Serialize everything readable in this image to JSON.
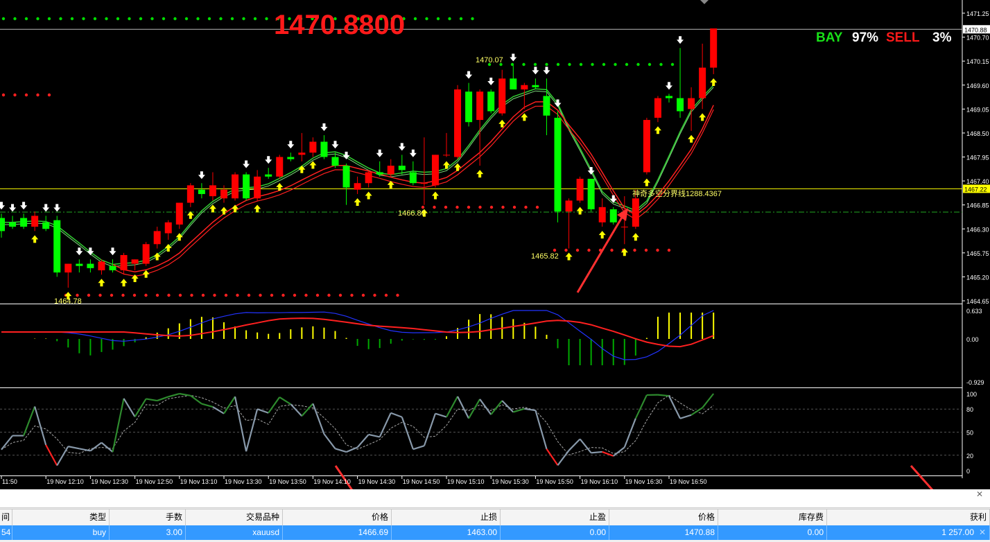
{
  "header": {
    "current_price": "1470.8800",
    "buy_label": "BAY",
    "buy_pct": "97%",
    "sell_label": "SELL",
    "sell_pct": "3%"
  },
  "price_axis": [
    "1471.25",
    "1470.70",
    "1470.15",
    "1469.60",
    "1469.05",
    "1468.50",
    "1467.95",
    "1467.40",
    "1466.85",
    "1466.30",
    "1465.75",
    "1465.20",
    "1464.65"
  ],
  "price_tags": {
    "current": "1470.88",
    "line": "1467.22"
  },
  "annotations": {
    "high_label": "1470.07",
    "mid_low_label": "1466.80",
    "low_label": "1465.82",
    "bottom_low_label": "1464.78",
    "divider_text": "神奇多空分界线1288.4367"
  },
  "macd_axis": [
    "0.633",
    "0.00",
    "-0.929"
  ],
  "stoch_axis": [
    "100",
    "80",
    "50",
    "20",
    "0"
  ],
  "time_axis": [
    "11:50",
    "19 Nov 12:10",
    "19 Nov 12:30",
    "19 Nov 12:50",
    "19 Nov 13:10",
    "19 Nov 13:30",
    "19 Nov 13:50",
    "19 Nov 14:10",
    "19 Nov 14:30",
    "19 Nov 14:50",
    "19 Nov 15:10",
    "19 Nov 15:30",
    "19 Nov 15:50",
    "19 Nov 16:10",
    "19 Nov 16:30",
    "19 Nov 16:50"
  ],
  "colors": {
    "bull": "#00ff00",
    "bear": "#ff0000",
    "up_arrow": "#ffff00",
    "down_arrow": "#ffffff",
    "ma_green": "#32cd32",
    "ma_red": "#ff2020",
    "dots_green": "#00dd00",
    "dots_red": "#ff2020",
    "hline": "#ffff00",
    "arrow_annot": "#ff3030"
  },
  "candles": [
    {
      "o": 1466.55,
      "h": 1466.65,
      "l": 1466.1,
      "c": 1466.25
    },
    {
      "o": 1466.45,
      "h": 1466.6,
      "l": 1466.3,
      "c": 1466.35
    },
    {
      "o": 1466.55,
      "h": 1466.65,
      "l": 1466.3,
      "c": 1466.35
    },
    {
      "o": 1466.35,
      "h": 1466.7,
      "l": 1466.25,
      "c": 1466.6
    },
    {
      "o": 1466.45,
      "h": 1466.6,
      "l": 1466.25,
      "c": 1466.3
    },
    {
      "o": 1466.5,
      "h": 1466.6,
      "l": 1465.2,
      "c": 1465.3
    },
    {
      "o": 1465.3,
      "h": 1465.5,
      "l": 1464.95,
      "c": 1465.5
    },
    {
      "o": 1465.5,
      "h": 1465.6,
      "l": 1465.3,
      "c": 1465.45
    },
    {
      "o": 1465.5,
      "h": 1465.6,
      "l": 1465.3,
      "c": 1465.4
    },
    {
      "o": 1465.35,
      "h": 1465.6,
      "l": 1465.25,
      "c": 1465.55
    },
    {
      "o": 1465.45,
      "h": 1465.6,
      "l": 1465.3,
      "c": 1465.35
    },
    {
      "o": 1465.35,
      "h": 1465.75,
      "l": 1465.25,
      "c": 1465.7
    },
    {
      "o": 1465.5,
      "h": 1465.6,
      "l": 1465.35,
      "c": 1465.6
    },
    {
      "o": 1465.5,
      "h": 1466.0,
      "l": 1465.45,
      "c": 1465.95
    },
    {
      "o": 1465.95,
      "h": 1466.35,
      "l": 1465.85,
      "c": 1466.25
    },
    {
      "o": 1466.2,
      "h": 1466.5,
      "l": 1466.05,
      "c": 1466.45
    },
    {
      "o": 1466.4,
      "h": 1466.9,
      "l": 1466.3,
      "c": 1466.9
    },
    {
      "o": 1466.9,
      "h": 1467.35,
      "l": 1466.8,
      "c": 1467.3
    },
    {
      "o": 1467.2,
      "h": 1467.35,
      "l": 1467.0,
      "c": 1467.1
    },
    {
      "o": 1467.05,
      "h": 1467.6,
      "l": 1466.95,
      "c": 1467.3
    },
    {
      "o": 1467.0,
      "h": 1467.3,
      "l": 1466.9,
      "c": 1467.2
    },
    {
      "o": 1467.0,
      "h": 1467.6,
      "l": 1466.95,
      "c": 1467.55
    },
    {
      "o": 1467.55,
      "h": 1467.6,
      "l": 1466.95,
      "c": 1467.0
    },
    {
      "o": 1467.0,
      "h": 1467.65,
      "l": 1466.95,
      "c": 1467.5
    },
    {
      "o": 1467.55,
      "h": 1467.7,
      "l": 1467.45,
      "c": 1467.5
    },
    {
      "o": 1467.5,
      "h": 1468.0,
      "l": 1467.45,
      "c": 1467.95
    },
    {
      "o": 1467.95,
      "h": 1468.05,
      "l": 1467.85,
      "c": 1467.9
    },
    {
      "o": 1468.0,
      "h": 1468.5,
      "l": 1467.85,
      "c": 1468.05
    },
    {
      "o": 1468.05,
      "h": 1468.4,
      "l": 1467.95,
      "c": 1468.3
    },
    {
      "o": 1468.3,
      "h": 1468.45,
      "l": 1467.9,
      "c": 1467.95
    },
    {
      "o": 1467.95,
      "h": 1468.05,
      "l": 1467.7,
      "c": 1467.75
    },
    {
      "o": 1467.75,
      "h": 1467.8,
      "l": 1466.85,
      "c": 1467.25
    },
    {
      "o": 1467.2,
      "h": 1467.5,
      "l": 1467.1,
      "c": 1467.35
    },
    {
      "o": 1467.35,
      "h": 1467.65,
      "l": 1467.25,
      "c": 1467.6
    },
    {
      "o": 1467.6,
      "h": 1467.85,
      "l": 1467.5,
      "c": 1467.55
    },
    {
      "o": 1467.55,
      "h": 1467.9,
      "l": 1467.5,
      "c": 1467.75
    },
    {
      "o": 1467.75,
      "h": 1468.0,
      "l": 1467.55,
      "c": 1467.65
    },
    {
      "o": 1467.6,
      "h": 1467.85,
      "l": 1467.3,
      "c": 1467.35
    },
    {
      "o": 1467.35,
      "h": 1468.4,
      "l": 1466.85,
      "c": 1467.35
    },
    {
      "o": 1467.3,
      "h": 1468.0,
      "l": 1467.25,
      "c": 1468.0
    },
    {
      "o": 1468.0,
      "h": 1468.5,
      "l": 1467.95,
      "c": 1468.0
    },
    {
      "o": 1467.95,
      "h": 1469.6,
      "l": 1467.9,
      "c": 1469.5
    },
    {
      "o": 1469.45,
      "h": 1469.65,
      "l": 1468.65,
      "c": 1468.75
    },
    {
      "o": 1468.8,
      "h": 1469.5,
      "l": 1467.75,
      "c": 1469.45
    },
    {
      "o": 1469.45,
      "h": 1469.5,
      "l": 1468.95,
      "c": 1469.0
    },
    {
      "o": 1468.95,
      "h": 1469.95,
      "l": 1468.9,
      "c": 1469.75
    },
    {
      "o": 1469.75,
      "h": 1470.05,
      "l": 1469.5,
      "c": 1469.5
    },
    {
      "o": 1469.5,
      "h": 1469.65,
      "l": 1469.05,
      "c": 1469.6
    },
    {
      "o": 1469.6,
      "h": 1469.75,
      "l": 1469.5,
      "c": 1469.55
    },
    {
      "o": 1469.35,
      "h": 1469.75,
      "l": 1468.45,
      "c": 1468.9
    },
    {
      "o": 1468.85,
      "h": 1469.0,
      "l": 1466.45,
      "c": 1466.7
    },
    {
      "o": 1466.7,
      "h": 1467.0,
      "l": 1465.85,
      "c": 1466.95
    },
    {
      "o": 1466.95,
      "h": 1467.5,
      "l": 1466.9,
      "c": 1467.45
    },
    {
      "o": 1467.45,
      "h": 1467.45,
      "l": 1466.7,
      "c": 1466.75
    },
    {
      "o": 1466.45,
      "h": 1467.0,
      "l": 1466.35,
      "c": 1466.8
    },
    {
      "o": 1466.75,
      "h": 1466.8,
      "l": 1466.4,
      "c": 1466.45
    },
    {
      "o": 1466.35,
      "h": 1467.05,
      "l": 1465.95,
      "c": 1466.35
    },
    {
      "o": 1466.35,
      "h": 1467.2,
      "l": 1466.3,
      "c": 1467.0
    },
    {
      "o": 1467.6,
      "h": 1468.85,
      "l": 1467.55,
      "c": 1468.8
    },
    {
      "o": 1468.85,
      "h": 1469.35,
      "l": 1468.75,
      "c": 1469.3
    },
    {
      "o": 1469.35,
      "h": 1469.4,
      "l": 1469.2,
      "c": 1469.3
    },
    {
      "o": 1469.3,
      "h": 1470.45,
      "l": 1468.85,
      "c": 1469.0
    },
    {
      "o": 1469.05,
      "h": 1469.55,
      "l": 1468.55,
      "c": 1469.3
    },
    {
      "o": 1469.3,
      "h": 1470.55,
      "l": 1469.05,
      "c": 1470.0
    },
    {
      "o": 1470.0,
      "h": 1470.9,
      "l": 1469.85,
      "c": 1470.9
    }
  ]
}
